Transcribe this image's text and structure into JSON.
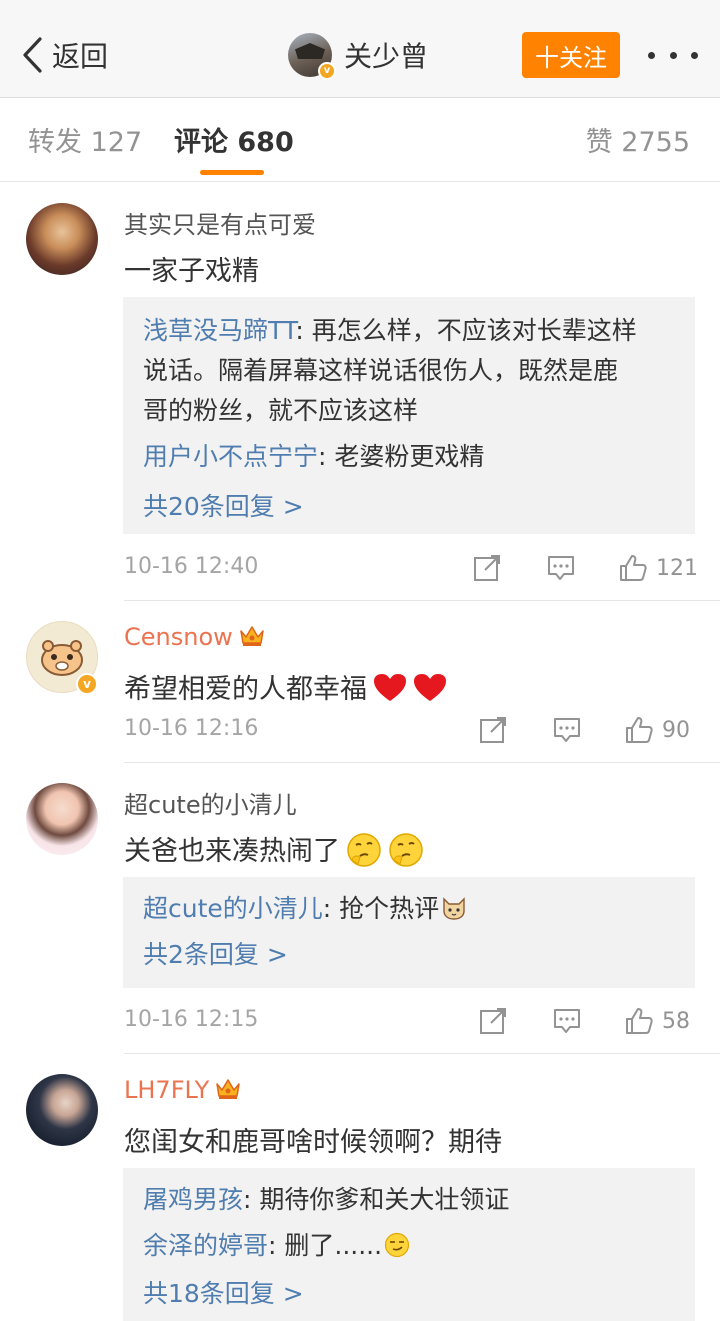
{
  "navbar": {
    "back_label": "返回",
    "title": "关少曾",
    "follow_label": "十关注"
  },
  "tabs": {
    "repost": "转发 127",
    "comment": "评论 680",
    "like": "赞 2755"
  },
  "colors": {
    "accent": "#ff8200",
    "link": "#507daf",
    "vip_name": "#eb7350",
    "verified": "#f5a623"
  },
  "comments": [
    {
      "username": "其实只是有点可爱",
      "text": "一家子戏精",
      "replies": [
        {
          "name": "浅草没马蹄TT",
          "text": ": 再怎么样，不应该对长辈这样"
        },
        {
          "text": "说话。隔着屏幕这样说话很伤人，既然是鹿"
        },
        {
          "text": "哥的粉丝，就不应该这样"
        },
        {
          "name": "用户小不点宁宁",
          "text": ": 老婆粉更戏精"
        }
      ],
      "more_replies": "共20条回复 >",
      "time": "10-16 12:40",
      "likes": "121"
    },
    {
      "username": "Censnow",
      "text": "希望相爱的人都幸福",
      "time": "10-16 12:16",
      "likes": "90"
    },
    {
      "username": "超cute的小清儿",
      "text": "关爸也来凑热闹了",
      "replies": [
        {
          "name": "超cute的小清儿",
          "text": ": 抢个热评"
        }
      ],
      "more_replies": "共2条回复 >",
      "time": "10-16 12:15",
      "likes": "58"
    },
    {
      "username": "LH7FLY",
      "text": "您闺女和鹿哥啥时候领啊？期待",
      "replies": [
        {
          "name": "屠鸡男孩",
          "text": ": 期待你爹和关大壮领证"
        },
        {
          "name": "余泽的婷哥",
          "text": ": 删了......"
        }
      ],
      "more_replies": "共18条回复 >"
    }
  ]
}
